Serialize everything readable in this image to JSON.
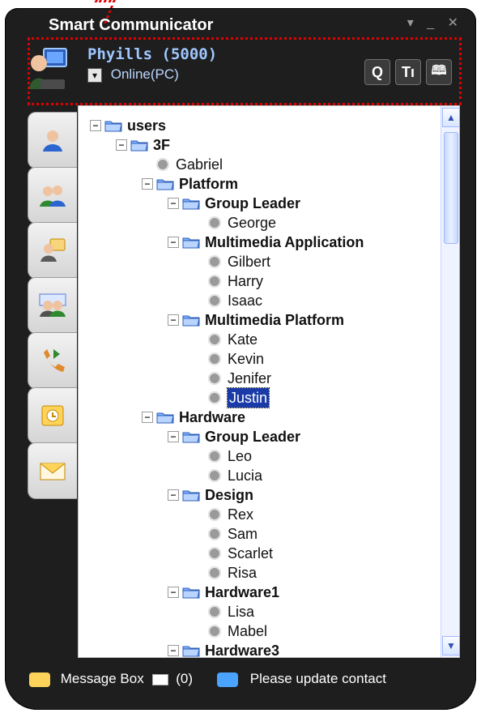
{
  "app": {
    "title": "Smart Communicator",
    "window_controls": "▾ _ ✕"
  },
  "profile": {
    "name": "Phyills (5000)",
    "status": "Online(PC)"
  },
  "toolbar": {
    "search_label": "Q",
    "settings_label": "Tı",
    "book_label": "🕮"
  },
  "tree": {
    "rows": [
      {
        "label": "users",
        "type": "group"
      },
      {
        "label": "3F",
        "type": "group"
      },
      {
        "label": "Gabriel",
        "type": "user"
      },
      {
        "label": "Platform",
        "type": "group"
      },
      {
        "label": "Group Leader",
        "type": "group"
      },
      {
        "label": "George",
        "type": "user"
      },
      {
        "label": "Multimedia Application",
        "type": "group"
      },
      {
        "label": "Gilbert",
        "type": "user"
      },
      {
        "label": "Harry",
        "type": "user"
      },
      {
        "label": "Isaac",
        "type": "user"
      },
      {
        "label": "Multimedia Platform",
        "type": "group"
      },
      {
        "label": "Kate",
        "type": "user"
      },
      {
        "label": "Kevin",
        "type": "user"
      },
      {
        "label": "Jenifer",
        "type": "user"
      },
      {
        "label": "Justin",
        "type": "user",
        "selected": true
      },
      {
        "label": "Hardware",
        "type": "group"
      },
      {
        "label": "Group Leader",
        "type": "group"
      },
      {
        "label": "Leo",
        "type": "user"
      },
      {
        "label": "Lucia",
        "type": "user"
      },
      {
        "label": "Design",
        "type": "group"
      },
      {
        "label": "Rex",
        "type": "user"
      },
      {
        "label": "Sam",
        "type": "user"
      },
      {
        "label": "Scarlet",
        "type": "user"
      },
      {
        "label": "Risa",
        "type": "user"
      },
      {
        "label": "Hardware1",
        "type": "group"
      },
      {
        "label": "Lisa",
        "type": "user"
      },
      {
        "label": "Mabel",
        "type": "user"
      },
      {
        "label": "Hardware3",
        "type": "group"
      }
    ]
  },
  "footer": {
    "message_box_label": "Message Box",
    "message_count": "(0)",
    "update_label": "Please update contact"
  },
  "colors": {
    "frame": "#1e1e1e",
    "selection": "#1a3ba7",
    "annotation": "#e10000",
    "scroll": "#eef3ff"
  },
  "icons": [
    "avatar-icon",
    "search-icon",
    "settings-icon",
    "address-book-icon",
    "user-tab-icon",
    "group-tab-icon",
    "chat-tab-icon",
    "conference-tab-icon",
    "call-tab-icon",
    "calendar-tab-icon",
    "mail-tab-icon",
    "message-box-icon",
    "envelope-icon",
    "update-contact-icon",
    "folder-icon",
    "user-icon",
    "expand-icon",
    "scroll-up-icon",
    "scroll-down-icon"
  ]
}
